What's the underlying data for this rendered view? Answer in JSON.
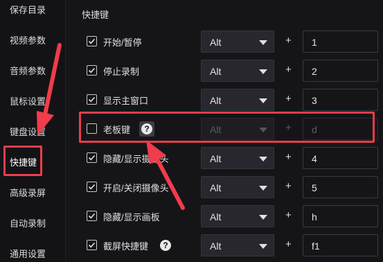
{
  "sidebar": {
    "items": [
      {
        "label": "保存目录"
      },
      {
        "label": "视频参数"
      },
      {
        "label": "音频参数"
      },
      {
        "label": "鼠标设置"
      },
      {
        "label": "键盘设置"
      },
      {
        "label": "快捷键",
        "active": true
      },
      {
        "label": "高级录屏"
      },
      {
        "label": "自动录制"
      },
      {
        "label": "通用设置"
      }
    ]
  },
  "section": {
    "title": "快捷键"
  },
  "rows": [
    {
      "label": "开始/暂停",
      "checked": true,
      "modifier": "Alt",
      "plus": "+",
      "key": "1"
    },
    {
      "label": "停止录制",
      "checked": true,
      "modifier": "Alt",
      "plus": "+",
      "key": "2"
    },
    {
      "label": "显示主窗口",
      "checked": true,
      "modifier": "Alt",
      "plus": "+",
      "key": "3"
    },
    {
      "label": "老板键",
      "checked": false,
      "help": "?",
      "modifier": "Alt",
      "plus": "+",
      "key": "d",
      "disabled": true
    },
    {
      "label": "隐藏/显示摄像头",
      "checked": true,
      "modifier": "Alt",
      "plus": "+",
      "key": "4"
    },
    {
      "label": "开启/关闭摄像头",
      "checked": true,
      "modifier": "Alt",
      "plus": "+",
      "key": "5"
    },
    {
      "label": "隐藏/显示画板",
      "checked": true,
      "modifier": "Alt",
      "plus": "+",
      "key": "h"
    },
    {
      "label": "截屏快捷键",
      "checked": true,
      "help": "?",
      "modifier": "Alt",
      "plus": "+",
      "key": "f1"
    }
  ],
  "colors": {
    "highlight": "#f03c4b",
    "background": "#151518"
  }
}
